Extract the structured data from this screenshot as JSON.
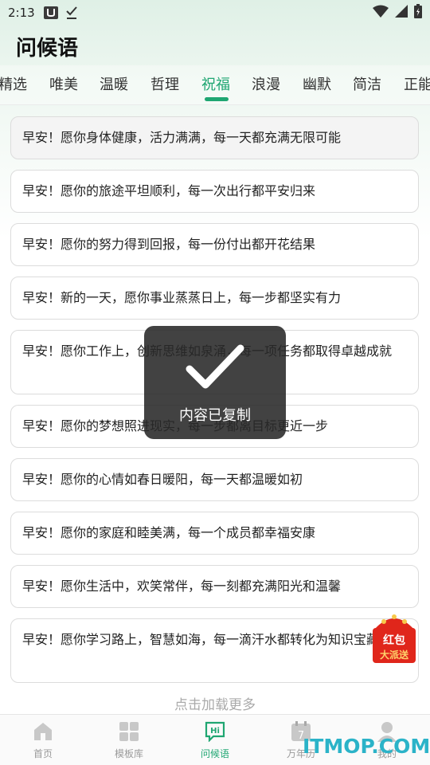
{
  "status_bar": {
    "time": "2:13"
  },
  "app": {
    "title": "问候语"
  },
  "tabs": [
    {
      "label": "精选"
    },
    {
      "label": "唯美"
    },
    {
      "label": "温暖"
    },
    {
      "label": "哲理"
    },
    {
      "label": "祝福",
      "active": true
    },
    {
      "label": "浪漫"
    },
    {
      "label": "幽默"
    },
    {
      "label": "简洁"
    },
    {
      "label": "正能"
    }
  ],
  "greetings": [
    "早安！愿你身体健康，活力满满，每一天都充满无限可能",
    "早安！愿你的旅途平坦顺利，每一次出行都平安归来",
    "早安！愿你的努力得到回报，每一份付出都开花结果",
    "早安！新的一天，愿你事业蒸蒸日上，每一步都坚实有力",
    "早安！愿你工作上，创新思维如泉涌，每一项任务都取得卓越成就",
    "早安！愿你的梦想照进现实，每一步都离目标更近一步",
    "早安！愿你的心情如春日暖阳，每一天都温暖如初",
    "早安！愿你的家庭和睦美满，每一个成员都幸福安康",
    "早安！愿你生活中，欢笑常伴，每一刻都充满阳光和温馨",
    "早安！愿你学习路上，智慧如海，每一滴汗水都转化为知识宝藏"
  ],
  "load_more": "点击加载更多",
  "toast": {
    "message": "内容已复制"
  },
  "red_packet": {
    "line1": "红包",
    "line2": "大派送"
  },
  "bottom_nav": [
    {
      "label": "首页",
      "icon": "home-icon"
    },
    {
      "label": "模板库",
      "icon": "grid-icon"
    },
    {
      "label": "问候语",
      "icon": "hi-bubble-icon",
      "active": true
    },
    {
      "label": "万年历",
      "icon": "calendar-icon",
      "day": "7"
    },
    {
      "label": "我的",
      "icon": "user-icon"
    }
  ],
  "watermark": "ITMOP.COM",
  "colors": {
    "accent": "#1fa672",
    "toast_bg": "#282828",
    "red_packet": "#e0261b"
  }
}
